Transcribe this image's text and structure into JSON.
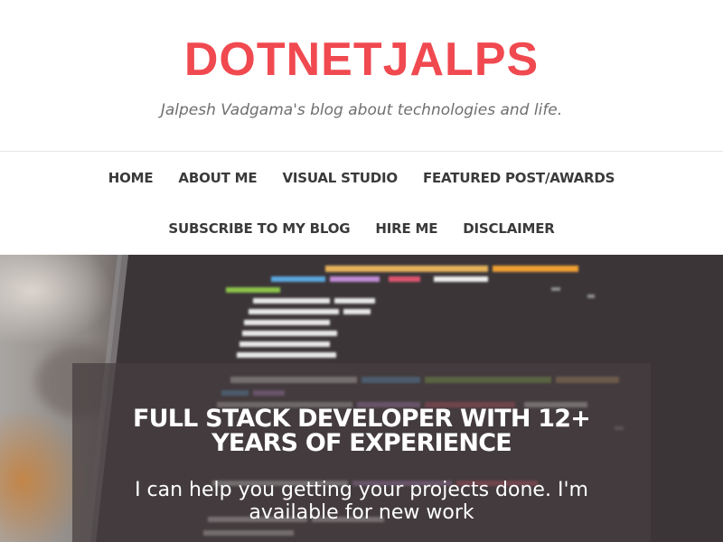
{
  "site": {
    "title": "DOTNETJALPS",
    "tagline": "Jalpesh Vadgama's blog about technologies and life."
  },
  "nav": {
    "row1": [
      "HOME",
      "ABOUT ME",
      "VISUAL STUDIO",
      "FEATURED POST/AWARDS"
    ],
    "row2": [
      "SUBSCRIBE TO MY BLOG",
      "HIRE ME",
      "DISCLAIMER"
    ]
  },
  "hero": {
    "heading": "FULL STACK DEVELOPER WITH 12+ YEARS OF EXPERIENCE",
    "subtext": "I can help you getting your projects done. I'm available for new work"
  },
  "colors": {
    "brand": "#f0494f",
    "tagline": "#6f6f6f",
    "nav_text": "#3a3a3a",
    "hero_overlay": "#463e40"
  }
}
